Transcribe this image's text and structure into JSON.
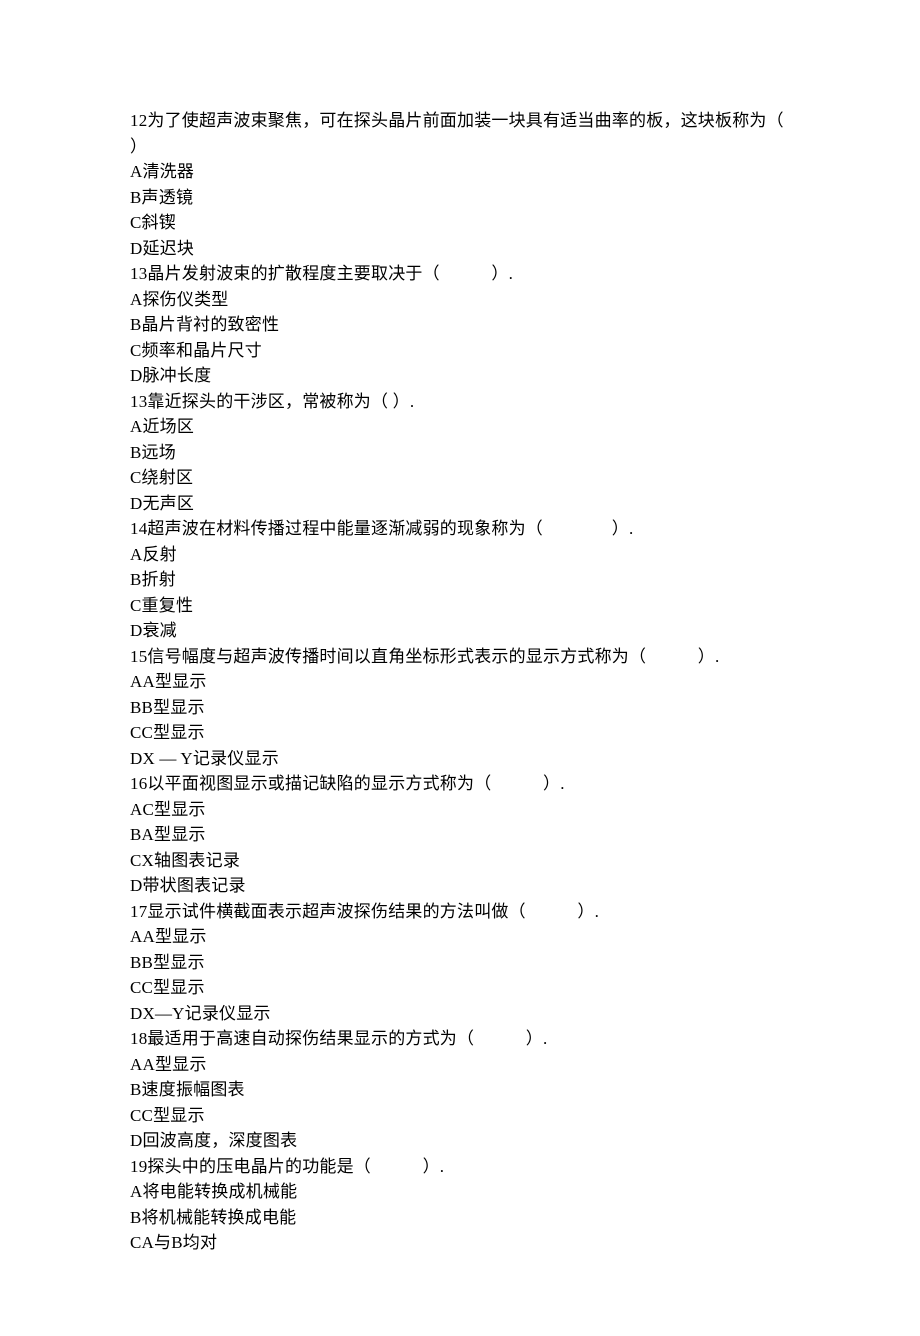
{
  "lines": [
    "12为了使超声波束聚焦，可在探头晶片前面加装一块具有适当曲率的板，这块板称为（ ）",
    "A清洗器",
    "B声透镜",
    "C斜锲",
    "D延迟块",
    "13晶片发射波束的扩散程度主要取决于（　　　）.",
    "A探伤仪类型",
    "B晶片背衬的致密性",
    "C频率和晶片尺寸",
    "D脉冲长度",
    "13靠近探头的干涉区，常被称为（ ）.",
    "A近场区",
    "B远场",
    "C绕射区",
    "D无声区",
    "14超声波在材料传播过程中能量逐渐减弱的现象称为（　　　　）.",
    "A反射",
    "B折射",
    "C重复性",
    "D衰减",
    "15信号幅度与超声波传播时间以直角坐标形式表示的显示方式称为（　　　）.",
    "AA型显示",
    "BB型显示",
    "CC型显示",
    "DX — Y记录仪显示",
    "16以平面视图显示或描记缺陷的显示方式称为（　　　）.",
    "AC型显示",
    "BA型显示",
    "CX轴图表记录",
    "D带状图表记录",
    "17显示试件横截面表示超声波探伤结果的方法叫做（　　　）.",
    "AA型显示",
    "BB型显示",
    "CC型显示",
    "DX—Y记录仪显示",
    "18最适用于高速自动探伤结果显示的方式为（　　　）.",
    "AA型显示",
    "B速度振幅图表",
    "CC型显示",
    "D回波高度，深度图表",
    "19探头中的压电晶片的功能是（　　　）.",
    "A将电能转换成机械能",
    "B将机械能转换成电能",
    "CA与B均对"
  ]
}
